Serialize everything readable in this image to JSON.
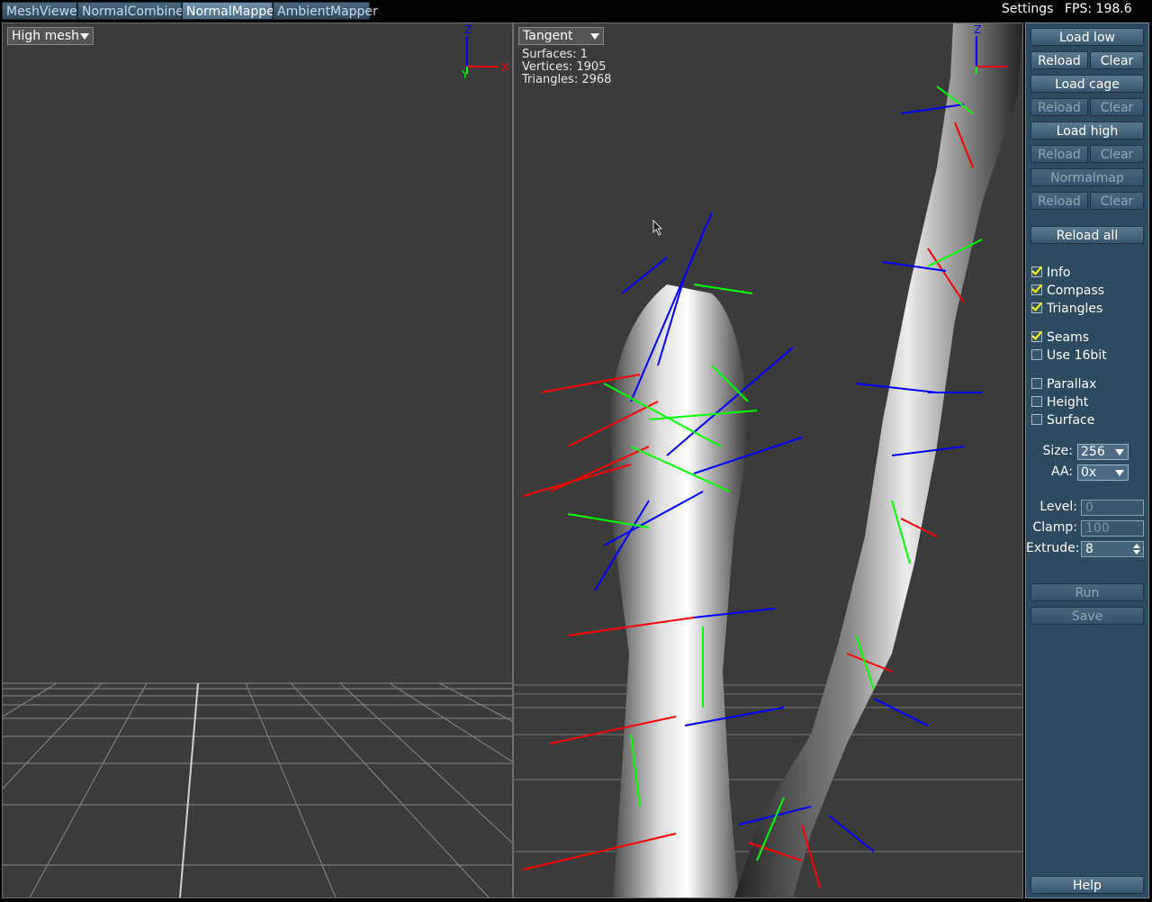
{
  "tabs": [
    {
      "label": "MeshViewer"
    },
    {
      "label": "NormalCombiner"
    },
    {
      "label": "NormalMapper"
    },
    {
      "label": "AmbientMapper"
    }
  ],
  "topbar": {
    "settings": "Settings",
    "fps": "FPS: 198.6"
  },
  "left_view": {
    "dropdown": "High mesh"
  },
  "right_view": {
    "dropdown": "Tangent",
    "info": {
      "surfaces": "Surfaces: 1",
      "vertices": "Vertices: 1905",
      "triangles": "Triangles: 2968"
    }
  },
  "compass": {
    "z": "Z",
    "x": "X",
    "y": "Y"
  },
  "panel": {
    "load_low": "Load low",
    "load_cage": "Load cage",
    "load_high": "Load high",
    "normalmap": "Normalmap",
    "reload": "Reload",
    "clear": "Clear",
    "reload_all": "Reload all",
    "checks": {
      "info": "Info",
      "compass": "Compass",
      "triangles": "Triangles",
      "seams": "Seams",
      "use16": "Use 16bit",
      "parallax": "Parallax",
      "height": "Height",
      "surface": "Surface"
    },
    "size_label": "Size:",
    "size_value": "256",
    "aa_label": "AA:",
    "aa_value": "0x",
    "level_label": "Level:",
    "level_value": "0",
    "clamp_label": "Clamp:",
    "clamp_value": "100",
    "extrude_label": "Extrude:",
    "extrude_value": "8",
    "run": "Run",
    "save": "Save",
    "help": "Help"
  },
  "colors": {
    "axis_x": "#ff0000",
    "axis_y": "#00ff00",
    "axis_z": "#0000ff",
    "panel": "#2d4a5f",
    "viewport": "#3b3b3b"
  }
}
